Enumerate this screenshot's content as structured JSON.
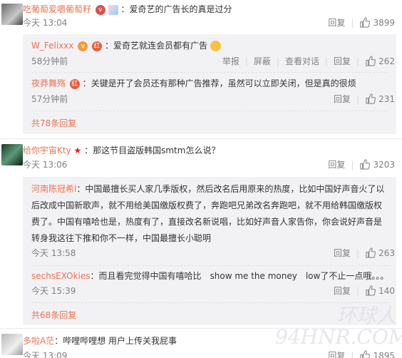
{
  "comments": [
    {
      "user": "吃葡萄爱嚼葡萄籽",
      "text": "：爱奇艺的广告长的真是过分",
      "time": "今天 13:04",
      "reply": "回复",
      "likes": "3899"
    },
    {
      "user": "给你宇宙Kty",
      "text": "：那这节目盗版韩国smtm怎么说？",
      "time": "今天 13:06",
      "reply": "回复",
      "likes": "3203"
    },
    {
      "user": "多啦A茫",
      "text": "：哔哩哔哩想 用户上传关我屁事",
      "time": "今天 13:09",
      "reply": "回复",
      "likes": "1895"
    }
  ],
  "sub1": [
    {
      "user": "W_Felixxx",
      "text": "：爱奇艺就连会员都有广告",
      "time": "58分钟前",
      "report": "举报",
      "block": "屏蔽",
      "view": "查看对话",
      "reply": "回复",
      "likes": "262"
    },
    {
      "user": "夜莽舞殇",
      "text": "：关键是开了会员还有那种广告推荐，虽然可以立即关闭，但是真的很烦",
      "time": "57分钟前",
      "reply": "回复",
      "likes": "231"
    }
  ],
  "sub1_more": "共78条回复",
  "sub2": [
    {
      "user": "河南陈冠希l",
      "lines": [
        "：中国最擅长买人家几季版权，然后改名后用原来的热度，比如中国好声音火了以",
        "后改成中国新歌声，就不用给美国缴版权费了，奔跑吧兄弟改名奔跑吧，就不用给韩国缴版权",
        "费了。中国有嘻哈也是，热度有了，直接改名新说唱，比如好声音人家告你，你会说好声音是",
        "转身我这往下推和你不一样，中国最擅长小聪明"
      ],
      "time": "今天 13:58",
      "reply": "回复",
      "likes": "263"
    },
    {
      "user": "sechsEXOkies",
      "text": "：而且看完觉得中国有嘻哈比　show me the money　low了不止一点哦。。。",
      "time": "今天 15:39",
      "reply": "回复",
      "likes": "140"
    }
  ],
  "sub2_more": "共68条回复",
  "watermark": "环球人 94HNR.COM",
  "colors": {
    "link": "#eb7350",
    "muted": "#808080",
    "sub_bg": "#f2f2f5"
  }
}
